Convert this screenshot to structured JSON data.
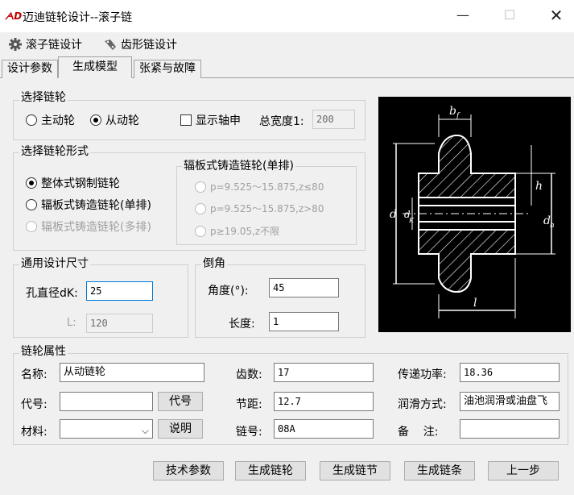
{
  "window": {
    "title": "迈迪链轮设计--滚子链",
    "icon_text": "ᗅD",
    "min": "—",
    "max": "☐",
    "close": "✕"
  },
  "toolbar": {
    "roller_chain": "滚子链设计",
    "tooth_chain": "齿形链设计"
  },
  "tabs": [
    "设计参数",
    "生成模型",
    "张紧与故障"
  ],
  "select_sprocket": {
    "title": "选择链轮",
    "driving": "主动轮",
    "driven": "从动轮",
    "selected": "从动轮",
    "show_shaft": "显示轴申",
    "total_width_label": "总宽度1:",
    "total_width_value": "200"
  },
  "sprocket_form": {
    "title": "选择链轮形式",
    "options": [
      "整体式钢制链轮",
      "辐板式铸造链轮(单排)",
      "辐板式铸造链轮(多排)"
    ],
    "selected": "整体式钢制链轮",
    "sub_title": "辐板式铸造链轮(单排)",
    "sub_options": [
      "p=9.525～15.875,z≤80",
      "p=9.525～15.875,z>80",
      "p≥19.05,z不限"
    ]
  },
  "general_dims": {
    "title": "通用设计尺寸",
    "bore_label": "孔直径dK:",
    "bore_value": "25",
    "l_label": "L:",
    "l_value": "120"
  },
  "chamfer": {
    "title": "倒角",
    "angle_label": "角度(°):",
    "angle_value": "45",
    "length_label": "长度:",
    "length_value": "1"
  },
  "diagram": {
    "labels": {
      "bf": "b",
      "bf_sub": "f",
      "d": "d",
      "dk": "d",
      "dk_sub": "K",
      "h": "h",
      "dh": "d",
      "dh_sub": "h",
      "l": "l"
    }
  },
  "properties": {
    "title": "链轮属性",
    "name_label": "名称:",
    "name_value": "从动链轮",
    "teeth_label": "齿数:",
    "teeth_value": "17",
    "power_label": "传递功率:",
    "power_value": "18.36",
    "code_label": "代号:",
    "code_value": "",
    "code_button": "代号",
    "pitch_label": "节距:",
    "pitch_value": "12.7",
    "lube_label": "润滑方式:",
    "lube_value": "油池润滑或油盘飞",
    "material_label": "材料:",
    "material_value": "",
    "explain_button": "说明",
    "chain_no_label": "链号:",
    "chain_no_value": "08A",
    "remark_label": "备    注:",
    "remark_value": ""
  },
  "buttons": {
    "tech_params": "技术参数",
    "gen_sprocket": "生成链轮",
    "gen_link": "生成链节",
    "gen_chain": "生成链条",
    "prev": "上一步"
  }
}
